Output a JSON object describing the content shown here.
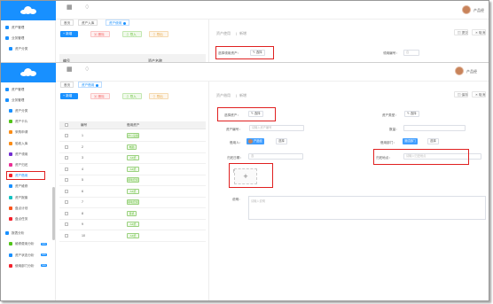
{
  "back": {
    "menu": [
      {
        "label": "资产管理"
      },
      {
        "label": "业务管理"
      },
      {
        "label": "资产分类"
      }
    ],
    "tabs": [
      "首页",
      "资产入库",
      "资产使用"
    ],
    "buttons": {
      "add": "新增",
      "delete": "删除",
      "import": "导入",
      "export": "导出"
    },
    "columns": [
      "编号",
      "资产名称"
    ],
    "user": "产品经",
    "panel": {
      "breadcrumb_a": "资产使用",
      "breadcrumb_b": "新增",
      "save": "提交",
      "cancel": "取消",
      "select_label": "选择领用资产：",
      "select_button": "选择",
      "number_label": "领用编号：",
      "number_value": "自"
    }
  },
  "front": {
    "menu": [
      {
        "label": "资产管理",
        "icon_color": "#1890ff"
      },
      {
        "label": "业务管理",
        "icon_color": "#1890ff"
      },
      {
        "label": "资产分类",
        "icon_color": "#1890ff"
      },
      {
        "label": "资产卡片",
        "icon_color": "#52c41a"
      },
      {
        "label": "采购申请",
        "icon_color": "#fa8c16"
      },
      {
        "label": "验收入库",
        "icon_color": "#fa8c16"
      },
      {
        "label": "资产领用",
        "icon_color": "#722ed1"
      },
      {
        "label": "资产归还",
        "icon_color": "#eb2f96"
      },
      {
        "label": "资产借用",
        "icon_color": "#f5222d"
      },
      {
        "label": "资产维修",
        "icon_color": "#1890ff"
      },
      {
        "label": "资产报废",
        "icon_color": "#13c2c2"
      },
      {
        "label": "盘点计划",
        "icon_color": "#fa541c"
      },
      {
        "label": "盘点任务",
        "icon_color": "#f5222d"
      },
      {
        "label": "报表分析",
        "icon_color": "#1890ff"
      },
      {
        "label": "维修费用分析",
        "icon_color": "#52c41a",
        "badge": "new"
      },
      {
        "label": "资产状态分析",
        "icon_color": "#1890ff",
        "badge": "new"
      },
      {
        "label": "使用部门分析",
        "icon_color": "#f5222d",
        "badge": "new"
      }
    ],
    "selected_menu_index": 8,
    "tabs": [
      "首页",
      "资产借用"
    ],
    "active_tab_index": 1,
    "buttons": {
      "add": "新增",
      "delete": "删除",
      "import": "导入",
      "export": "导出"
    },
    "columns": [
      "编号",
      "借用资产"
    ],
    "rows": [
      {
        "no": "1",
        "tag": "办公设备"
      },
      {
        "no": "2",
        "tag": "电脑"
      },
      {
        "no": "3",
        "tag": "A4纸"
      },
      {
        "no": "4",
        "tag": "A4纸"
      },
      {
        "no": "5",
        "tag": "钢笔套装"
      },
      {
        "no": "6",
        "tag": "A4纸"
      },
      {
        "no": "7",
        "tag": "钢笔套装"
      },
      {
        "no": "8",
        "tag": "耳机"
      },
      {
        "no": "9",
        "tag": "A4纸"
      },
      {
        "no": "10",
        "tag": "A4纸"
      }
    ],
    "user": "产品经",
    "panel": {
      "breadcrumb_a": "资产借用",
      "breadcrumb_b": "新增",
      "save": "保存",
      "cancel": "取消",
      "select_label": "选择资产：",
      "select_button": "选择",
      "type_label": "资产类型：",
      "type_button": "选择",
      "code_label": "资产编号：",
      "code_placeholder": "请输入资产编号",
      "qty_label": "数量：",
      "borrower_label": "借用人：",
      "borrower_value": "产品经",
      "borrower_button": "选择",
      "dept_label": "借用部门：",
      "dept_value": "测试部门",
      "dept_button": "选择",
      "date_label": "归还日期：",
      "date_value": "选",
      "return_label": "归还地点：",
      "return_placeholder": "请输入归还地点",
      "image_label": "图片：",
      "image_plus": "+",
      "remark_label": "说明：",
      "remark_placeholder": "请输入说明"
    }
  }
}
